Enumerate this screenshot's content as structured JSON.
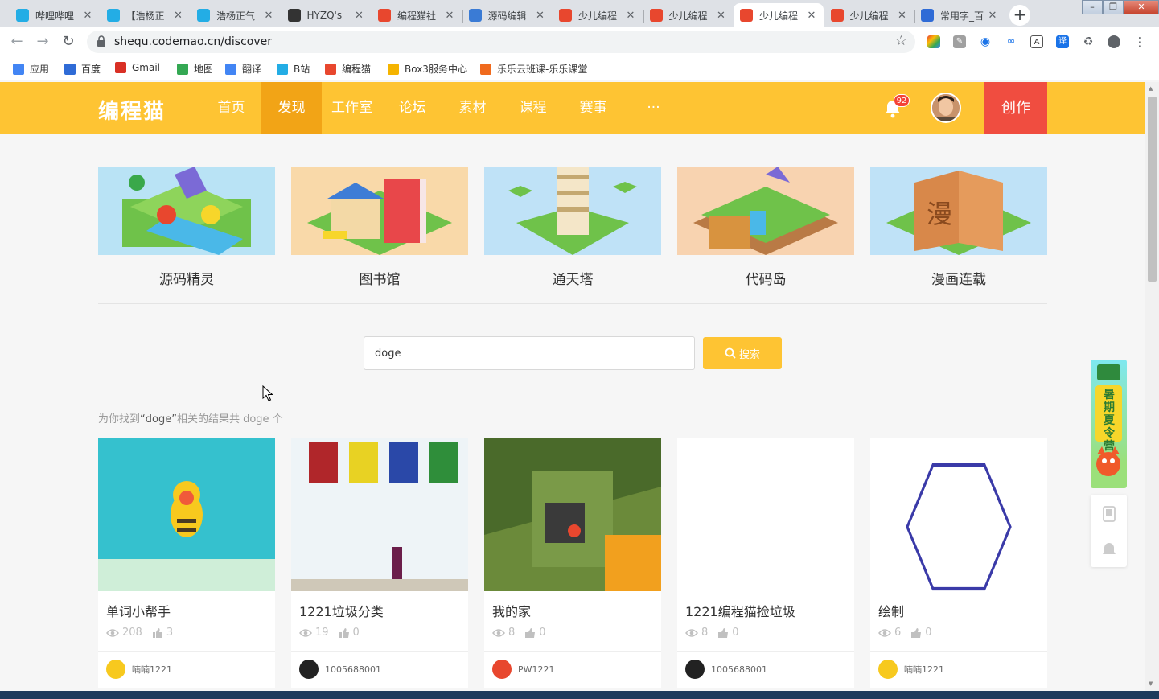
{
  "browser": {
    "tabs": [
      {
        "title": "哔哩哔哩",
        "fav_color": "#23ade5"
      },
      {
        "title": "【浩杨正",
        "fav_color": "#23ade5"
      },
      {
        "title": "浩杨正气",
        "fav_color": "#23ade5"
      },
      {
        "title": "HYZQ's",
        "fav_color": "#333333"
      },
      {
        "title": "编程猫社",
        "fav_color": "#e8472e"
      },
      {
        "title": "源码编辑",
        "fav_color": "#3a7bd5"
      },
      {
        "title": "少儿编程",
        "fav_color": "#e8472e"
      },
      {
        "title": "少儿编程",
        "fav_color": "#e8472e"
      },
      {
        "title": "少儿编程",
        "fav_color": "#e8472e",
        "active": true
      },
      {
        "title": "少儿编程",
        "fav_color": "#e8472e"
      },
      {
        "title": "常用字_百",
        "fav_color": "#2f6bd6"
      }
    ],
    "url": "shequ.codemao.cn/discover",
    "bookmarks": [
      {
        "label": "应用",
        "color": "#4285f4"
      },
      {
        "label": "百度",
        "color": "#2f6bd6"
      },
      {
        "label": "Gmail",
        "color": "#d93025"
      },
      {
        "label": "地图",
        "color": "#34a853"
      },
      {
        "label": "翻译",
        "color": "#4285f4"
      },
      {
        "label": "B站",
        "color": "#23ade5"
      },
      {
        "label": "编程猫",
        "color": "#e8472e"
      },
      {
        "label": "Box3服务中心",
        "color": "#f5b400"
      },
      {
        "label": "乐乐云班课-乐乐课堂",
        "color": "#f06a1d"
      }
    ]
  },
  "site": {
    "logo": "编程猫",
    "nav": [
      "首页",
      "发现",
      "工作室",
      "论坛",
      "素材",
      "课程",
      "赛事",
      "···"
    ],
    "active_nav": "发现",
    "notification_count": "92",
    "create_label": "创作",
    "brand_color": "#fec433"
  },
  "categories": [
    {
      "label": "源码精灵",
      "bg": "#b9e3f5"
    },
    {
      "label": "图书馆",
      "bg": "#f9d9a9"
    },
    {
      "label": "通天塔",
      "bg": "#bfe2f7"
    },
    {
      "label": "代码岛",
      "bg": "#f8d3b0"
    },
    {
      "label": "漫画连载",
      "bg": "#bfe2f7"
    }
  ],
  "search": {
    "value": "doge",
    "button_label": "搜索",
    "result_prefix": "为你找到",
    "result_keyword": "“doge”",
    "result_suffix": "相关的结果共 doge 个"
  },
  "projects": [
    {
      "title": "单词小帮手",
      "views": "208",
      "likes": "3",
      "author": "喃喃1221",
      "thumb": "bee"
    },
    {
      "title": "1221垃圾分类",
      "views": "19",
      "likes": "0",
      "author": "1005688001",
      "thumb": "bins"
    },
    {
      "title": "我的家",
      "views": "8",
      "likes": "0",
      "author": "PW1221",
      "thumb": "blocks"
    },
    {
      "title": "1221编程猫捡垃圾",
      "views": "8",
      "likes": "0",
      "author": "1005688001",
      "thumb": "blank"
    },
    {
      "title": "绘制",
      "views": "6",
      "likes": "0",
      "author": "喃喃1221",
      "thumb": "hexagon"
    }
  ],
  "promo": {
    "label": "暑期夏令营"
  }
}
